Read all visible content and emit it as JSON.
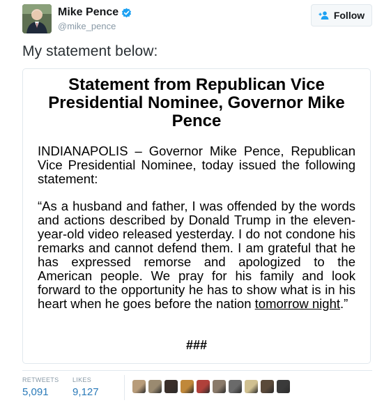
{
  "user": {
    "display_name": "Mike Pence",
    "handle": "@mike_pence",
    "verified": true
  },
  "follow_button": {
    "label": "Follow",
    "icon": "follow-user-icon"
  },
  "tweet": {
    "text": "My statement below:"
  },
  "statement": {
    "title": "Statement from Republican Vice Presidential Nominee, Governor Mike Pence",
    "paragraph1": "INDIANAPOLIS – Governor Mike Pence, Republican Vice Presidential Nominee, today issued the following statement:",
    "paragraph2_main": "“As a husband and father, I was offended by the words and actions described by Donald Trump in the eleven-year-old video released yesterday. I do not condone his remarks and cannot defend them. I am grateful that he has expressed remorse and apologized to the American people. We pray for his family and look forward to the opportunity he has to show what is in his heart when he goes before the nation ",
    "paragraph2_underlined": "tomorrow night",
    "paragraph2_end": ".”",
    "end_mark": "###"
  },
  "stats": {
    "retweets_label": "RETWEETS",
    "retweets_value": "5,091",
    "likes_label": "LIKES",
    "likes_value": "9,127"
  },
  "likers": {
    "colors": [
      "#b89c7a",
      "#9a8a70",
      "#3a2f2a",
      "#c0883a",
      "#b0403a",
      "#8a7a6a",
      "#6a6a6a",
      "#d0c090",
      "#5a4a3a",
      "#3a3a3a"
    ]
  },
  "colors": {
    "link": "#2a7ab9",
    "verified": "#1da1f2",
    "muted": "#8899a6"
  }
}
